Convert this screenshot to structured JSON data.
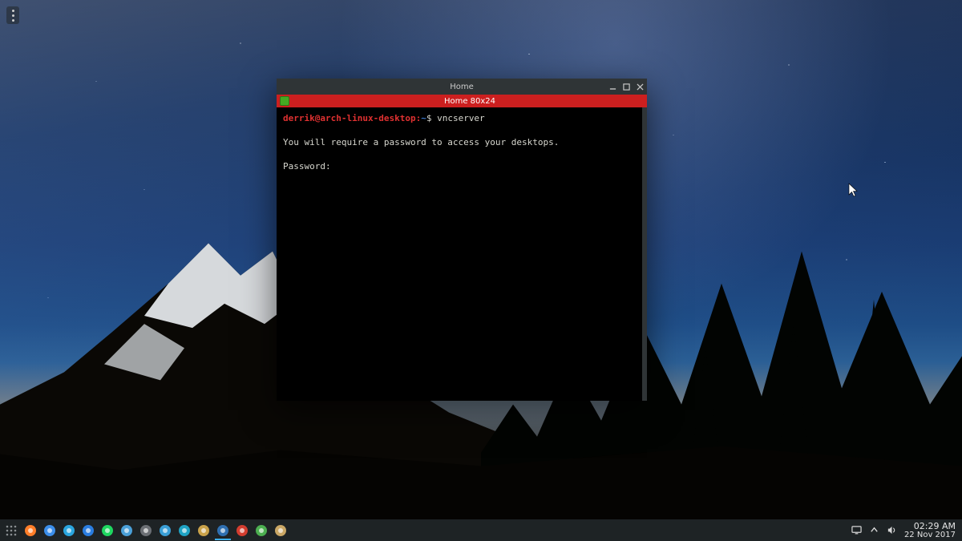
{
  "window": {
    "title": "Home",
    "tab_title": "Home 80x24",
    "controls": {
      "min": "minimize",
      "max": "maximize",
      "close": "close"
    }
  },
  "terminal": {
    "prompt_user": "derrik@arch-linux-desktop",
    "prompt_sep": ":",
    "prompt_path": "~",
    "prompt_symbol": "$ ",
    "command": "vncserver",
    "line1": "",
    "line2": "You will require a password to access your desktops.",
    "line3": "",
    "line4": "Password:"
  },
  "panel": {
    "launchers": [
      {
        "name": "app-launcher",
        "color": "#8a8f92"
      },
      {
        "name": "firefox",
        "color": "#ff7e29"
      },
      {
        "name": "chromium",
        "color": "#3b8eea"
      },
      {
        "name": "telegram",
        "color": "#2aa5de"
      },
      {
        "name": "mail",
        "color": "#2a7de0"
      },
      {
        "name": "spotify",
        "color": "#1ed760"
      },
      {
        "name": "browser-alt",
        "color": "#4aa0d8"
      },
      {
        "name": "steam",
        "color": "#6b6f74"
      },
      {
        "name": "deluge",
        "color": "#3a9fd6"
      },
      {
        "name": "kodi",
        "color": "#1fa3c4"
      },
      {
        "name": "utility",
        "color": "#c9a24a"
      },
      {
        "name": "virtualbox",
        "color": "#2f6fb0"
      },
      {
        "name": "office",
        "color": "#d33d2f"
      },
      {
        "name": "book",
        "color": "#4caf50"
      },
      {
        "name": "files",
        "color": "#caa765"
      }
    ],
    "tray": {
      "time": "02:29 AM",
      "date": "22 Nov 2017"
    }
  }
}
